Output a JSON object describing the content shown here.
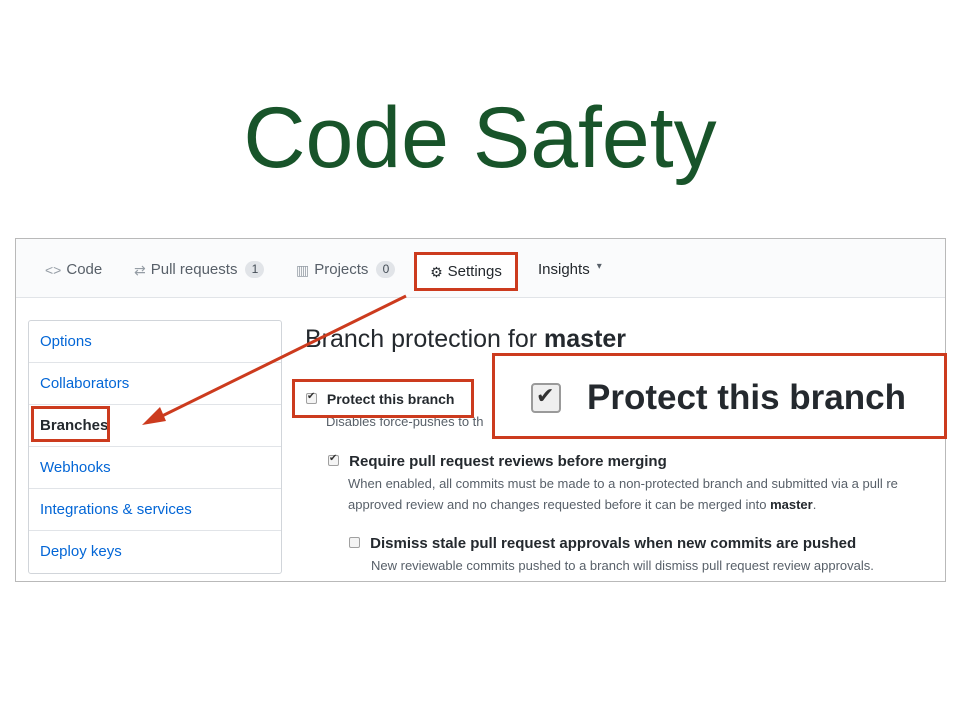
{
  "slide": {
    "title": "Code Safety"
  },
  "tabs": [
    {
      "icon": "code-icon",
      "glyph": "<>",
      "label": "Code"
    },
    {
      "icon": "pull-request-icon",
      "glyph": "⇄",
      "label": "Pull requests",
      "count": "1"
    },
    {
      "icon": "project-icon",
      "glyph": "▥",
      "label": "Projects",
      "count": "0"
    },
    {
      "icon": "gear-icon",
      "glyph": "⚙",
      "label": "Settings",
      "selected": true
    },
    {
      "icon": "graph-icon",
      "label": "Insights",
      "caret": "▾"
    }
  ],
  "sidebar": {
    "items": [
      {
        "label": "Options"
      },
      {
        "label": "Collaborators"
      },
      {
        "label": "Branches",
        "selected": true
      },
      {
        "label": "Webhooks"
      },
      {
        "label": "Integrations & services"
      },
      {
        "label": "Deploy keys"
      }
    ]
  },
  "main": {
    "heading_prefix": "Branch protection for",
    "branch": "master",
    "protect": {
      "label": "Protect this branch",
      "checked": true,
      "note": "Disables force-pushes to th"
    },
    "require_reviews": {
      "label": "Require pull request reviews before merging",
      "checked": true,
      "note_line1": "When enabled, all commits must be made to a non-protected branch and submitted via a pull re",
      "note_line2_prefix": "approved review and no changes requested before it can be merged into",
      "note_line2_branch": "master",
      "note_line2_suffix": "."
    },
    "dismiss_stale": {
      "label": "Dismiss stale pull request approvals when new commits are pushed",
      "checked": false,
      "note": "New reviewable commits pushed to a branch will dismiss pull request review approvals."
    }
  },
  "callout": {
    "label": "Protect this branch",
    "checked": true
  },
  "colors": {
    "title": "#18542a",
    "highlight": "#cc3b1e",
    "link": "#0366d6"
  }
}
